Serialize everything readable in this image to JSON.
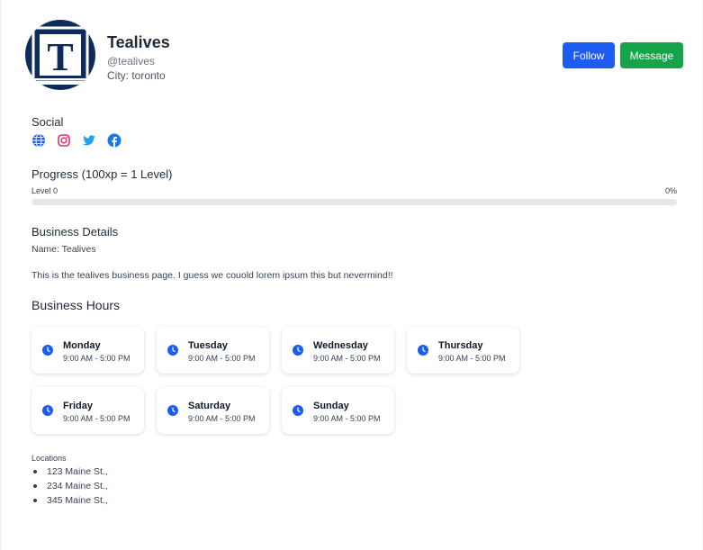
{
  "profile": {
    "name": "Tealives",
    "handle": "@tealives",
    "city": "City: toronto",
    "avatar_letter": "T"
  },
  "actions": {
    "follow_label": "Follow",
    "message_label": "Message"
  },
  "social": {
    "title": "Social",
    "icons": [
      "globe-icon",
      "instagram-icon",
      "twitter-icon",
      "facebook-icon"
    ]
  },
  "progress": {
    "title": "Progress (100xp = 1 Level)",
    "level_label": "Level 0",
    "percent_label": "0%",
    "fraction": 0
  },
  "business": {
    "title": "Business Details",
    "name": "Name: Tealives",
    "description": "This is the tealives business page. I guess we couold lorem ipsum this but nevermind!!"
  },
  "hours": {
    "title": "Business Hours",
    "days": [
      {
        "day": "Monday",
        "time": "9:00 AM - 5:00 PM"
      },
      {
        "day": "Tuesday",
        "time": "9:00 AM - 5:00 PM"
      },
      {
        "day": "Wednesday",
        "time": "9:00 AM - 5:00 PM"
      },
      {
        "day": "Thursday",
        "time": "9:00 AM - 5:00 PM"
      },
      {
        "day": "Friday",
        "time": "9:00 AM - 5:00 PM"
      },
      {
        "day": "Saturday",
        "time": "9:00 AM - 5:00 PM"
      },
      {
        "day": "Sunday",
        "time": "9:00 AM - 5:00 PM"
      }
    ]
  },
  "locations": {
    "title": "Locations",
    "items": [
      "123 Maine St.,",
      "234 Maine St.,",
      "345 Maine St.,"
    ]
  },
  "colors": {
    "primary": "#1d5cf0",
    "success": "#16a34a",
    "avatar_bg": "#0f2b5b",
    "instagram": "#e1306c",
    "twitter": "#1da1f2",
    "facebook": "#1877f2"
  }
}
